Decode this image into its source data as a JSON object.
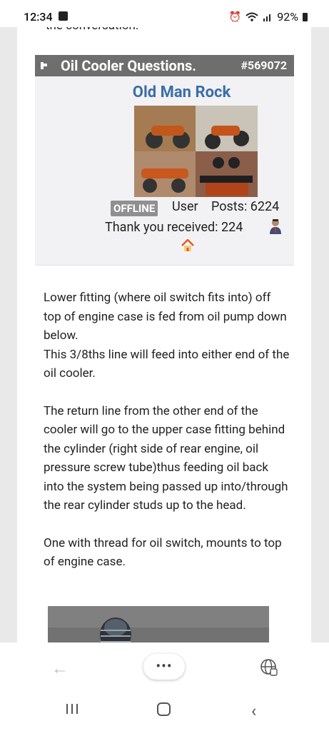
{
  "status_bar": {
    "time": "12:34",
    "battery": "92%"
  },
  "page": {
    "cut_text": "the conversation.",
    "post": {
      "title": "Oil Cooler Questions.",
      "number": "#569072",
      "author": "Old Man Rock",
      "status_badge": "OFFLINE",
      "rank": "User",
      "posts": "Posts: 6224",
      "thanks": "Thank you received: 224",
      "body": [
        "Lower fitting (where oil switch fits into) off top of engine case is fed from oil pump down below.\nThis 3/8ths line will feed into either end of the oil cooler.",
        "The return line from the other end of the cooler will go to the upper case fitting behind the cylinder (right side of rear engine, oil pressure screw tube)thus feeding oil back into the system being passed up into/through the rear cylinder studs up to the head.",
        "One with thread for oil switch, mounts to top of engine case."
      ]
    }
  },
  "browser": {
    "menu_label": "•••"
  },
  "icons": {
    "pin": "pin-icon",
    "person": "person-icon",
    "home": "home-icon",
    "back": "back-arrow-icon",
    "globe": "globe-icon"
  },
  "colors": {
    "header_bg": "#6e6e6e",
    "author": "#3c6ea8",
    "badge": "#8f8f8f"
  }
}
